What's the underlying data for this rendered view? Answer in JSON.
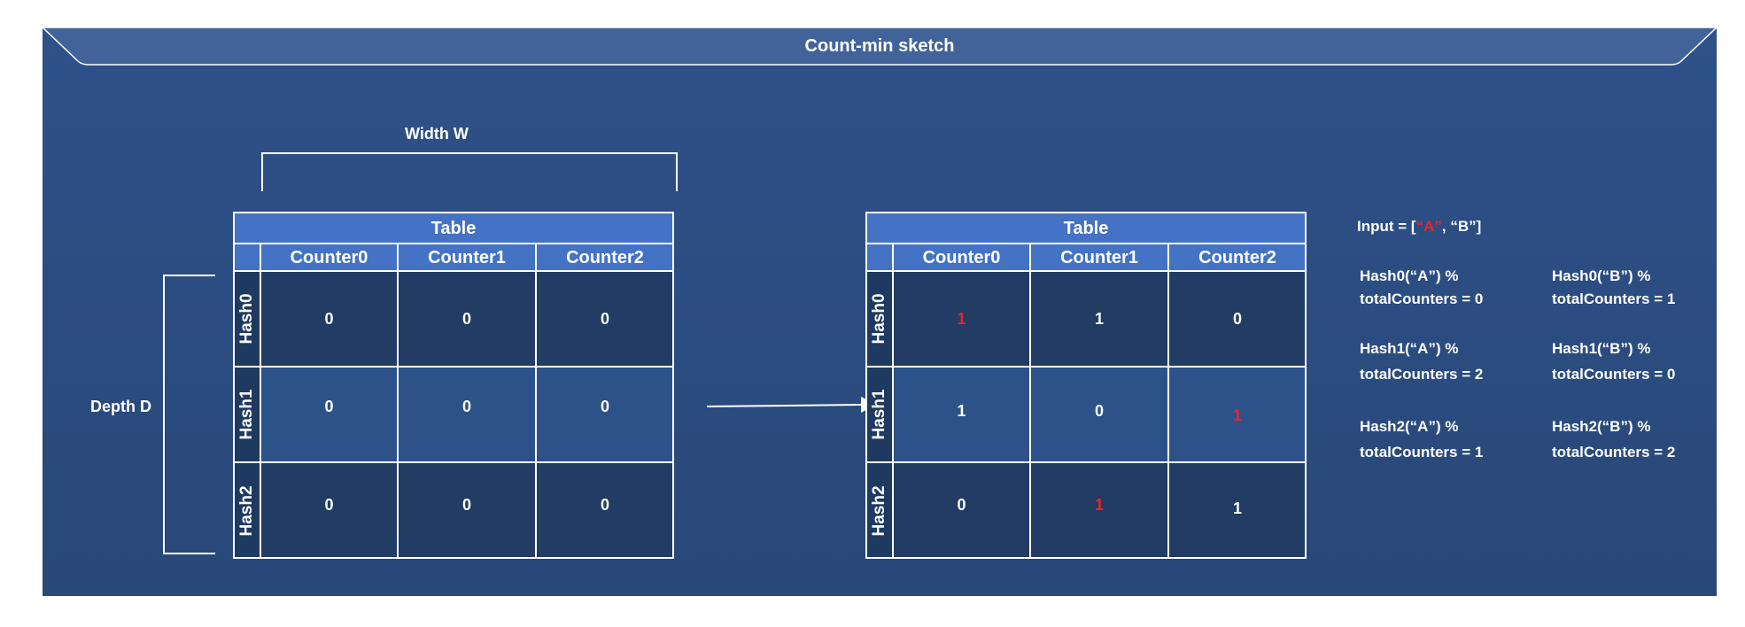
{
  "title": "Count-min sketch",
  "width_label": "Width W",
  "depth_label": "Depth D",
  "left_table": {
    "title": "Table",
    "columns": [
      "Counter0",
      "Counter1",
      "Counter2"
    ],
    "rows": [
      {
        "label": "Hash0",
        "values": [
          "0",
          "0",
          "0"
        ]
      },
      {
        "label": "Hash1",
        "values": [
          "0",
          "0",
          "0"
        ]
      },
      {
        "label": "Hash2",
        "values": [
          "0",
          "0",
          "0"
        ]
      }
    ]
  },
  "right_table": {
    "title": "Table",
    "columns": [
      "Counter0",
      "Counter1",
      "Counter2"
    ],
    "rows": [
      {
        "label": "Hash0",
        "values": [
          "1",
          "1",
          "0"
        ]
      },
      {
        "label": "Hash1",
        "values": [
          "1",
          "0",
          "1"
        ]
      },
      {
        "label": "Hash2",
        "values": [
          "0",
          "1",
          "1"
        ]
      }
    ]
  },
  "input": {
    "prefix": "Input = [",
    "a": "“A”",
    "sep": ", ",
    "b": "“B”",
    "suffix": "]"
  },
  "hash_results": {
    "a": [
      {
        "line1": "Hash0(“A”) %",
        "line2": "totalCounters = 0"
      },
      {
        "line1": "Hash1(“A”) %",
        "line2": "totalCounters = 2"
      },
      {
        "line1": "Hash2(“A”) %",
        "line2": "totalCounters = 1"
      }
    ],
    "b": [
      {
        "line1": "Hash0(“B”) %",
        "line2": "totalCounters = 1"
      },
      {
        "line1": "Hash1(“B”) %",
        "line2": "totalCounters = 0"
      },
      {
        "line1": "Hash2(“B”) %",
        "line2": "totalCounters = 2"
      }
    ]
  },
  "colors": {
    "background": "#2d5089",
    "table_header": "#4472c4",
    "highlight": "#e8262b"
  }
}
